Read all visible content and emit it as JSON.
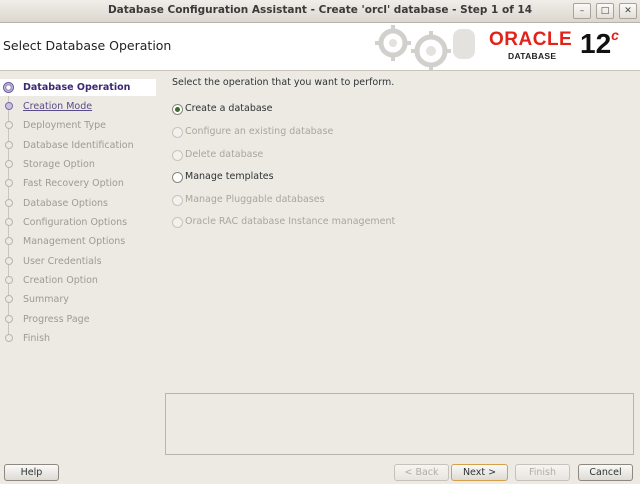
{
  "window": {
    "title": "Database Configuration Assistant - Create 'orcl' database - Step 1 of 14"
  },
  "header": {
    "title": "Select Database Operation",
    "brand": "ORACLE",
    "product": "DATABASE",
    "version": "12",
    "version_suffix": "c"
  },
  "steps": [
    {
      "label": "Database Operation",
      "state": "active"
    },
    {
      "label": "Creation Mode",
      "state": "link"
    },
    {
      "label": "Deployment Type",
      "state": "disabled"
    },
    {
      "label": "Database Identification",
      "state": "disabled"
    },
    {
      "label": "Storage Option",
      "state": "disabled"
    },
    {
      "label": "Fast Recovery Option",
      "state": "disabled"
    },
    {
      "label": "Database Options",
      "state": "disabled"
    },
    {
      "label": "Configuration Options",
      "state": "disabled"
    },
    {
      "label": "Management Options",
      "state": "disabled"
    },
    {
      "label": "User Credentials",
      "state": "disabled"
    },
    {
      "label": "Creation Option",
      "state": "disabled"
    },
    {
      "label": "Summary",
      "state": "disabled"
    },
    {
      "label": "Progress Page",
      "state": "disabled"
    },
    {
      "label": "Finish",
      "state": "disabled"
    }
  ],
  "main": {
    "prompt": "Select the operation that you want to perform.",
    "options": [
      {
        "label": "Create a database",
        "selected": true,
        "enabled": true
      },
      {
        "label": "Configure an existing database",
        "selected": false,
        "enabled": false
      },
      {
        "label": "Delete database",
        "selected": false,
        "enabled": false
      },
      {
        "label": "Manage templates",
        "selected": false,
        "enabled": true
      },
      {
        "label": "Manage Pluggable databases",
        "selected": false,
        "enabled": false
      },
      {
        "label": "Oracle RAC database Instance management",
        "selected": false,
        "enabled": false
      }
    ]
  },
  "buttons": {
    "help": "Help",
    "back": "< Back",
    "next": "Next >",
    "finish": "Finish",
    "cancel": "Cancel"
  },
  "colors": {
    "oracle_red": "#e2231a",
    "active_step": "#3c2873"
  }
}
